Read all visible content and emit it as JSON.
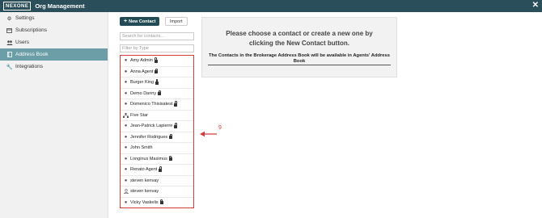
{
  "header": {
    "logo_text": "NEXONE",
    "title": "Org Management",
    "close_icon": "close-icon"
  },
  "sidebar": {
    "items": [
      {
        "label": "Settings",
        "icon": "gear-icon"
      },
      {
        "label": "Subscriptions",
        "icon": "card-icon"
      },
      {
        "label": "Users",
        "icon": "users-icon"
      },
      {
        "label": "Address Book",
        "icon": "book-icon",
        "active": true
      },
      {
        "label": "Integrations",
        "icon": "wrench-icon"
      }
    ]
  },
  "toolbar": {
    "new_contact_label": "New Contact",
    "import_label": "Import"
  },
  "search": {
    "placeholder": "Search for contacts..."
  },
  "filter": {
    "placeholder": "Filter by Type"
  },
  "contacts": [
    {
      "name": "Amy Admin",
      "icon": "user-circle-icon",
      "locked": true
    },
    {
      "name": "Anna Agent",
      "icon": "user-circle-icon",
      "locked": true
    },
    {
      "name": "Burger King",
      "icon": "user-circle-icon",
      "locked": true
    },
    {
      "name": "Demo Danny",
      "icon": "user-circle-icon",
      "locked": true
    },
    {
      "name": "Domenico Thisisatest",
      "icon": "user-circle-icon",
      "locked": true
    },
    {
      "name": "Five Star",
      "icon": "org-tree-icon",
      "locked": false
    },
    {
      "name": "Jean-Patrick Lapierre",
      "icon": "user-circle-icon",
      "locked": true
    },
    {
      "name": "Jennifer Rodrigues",
      "icon": "user-circle-icon",
      "locked": true
    },
    {
      "name": "John Smith",
      "icon": "user-circle-icon",
      "locked": false
    },
    {
      "name": "Longinus Maximus",
      "icon": "user-circle-icon",
      "locked": true
    },
    {
      "name": "Renato Agent",
      "icon": "user-circle-icon",
      "locked": true
    },
    {
      "name": "steven kenvay",
      "icon": "user-circle-icon",
      "locked": false
    },
    {
      "name": "steven kenvay",
      "icon": "user-outline-icon",
      "locked": false
    },
    {
      "name": "Vicky Vaskelis",
      "icon": "user-circle-icon",
      "locked": true
    }
  ],
  "annotation": {
    "number": "9",
    "color": "#d33a3a"
  },
  "panel": {
    "heading": "Please choose a contact or create a new one by clicking the New Contact button.",
    "subtext": "The Contacts in the Brokerage Address Book will be available in Agents' Address Book"
  },
  "colors": {
    "header_bg": "#2a4e5a",
    "sidebar_active": "#6b9ea6",
    "primary_button": "#234b55",
    "highlight": "#d33a3a"
  }
}
